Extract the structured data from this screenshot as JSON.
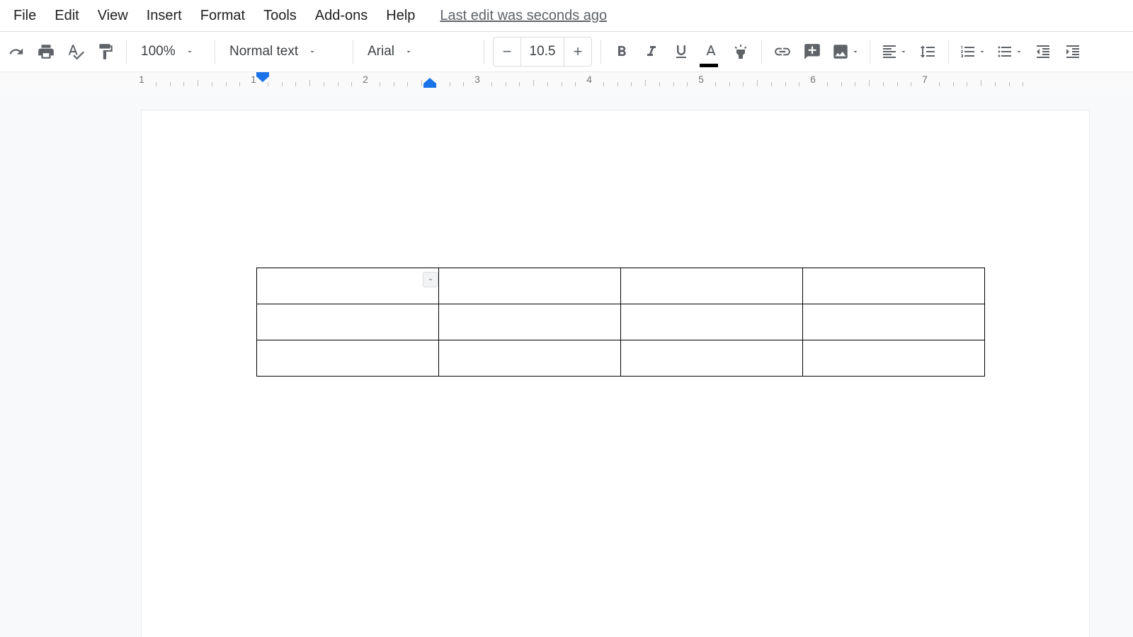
{
  "menu": {
    "items": [
      "File",
      "Edit",
      "View",
      "Insert",
      "Format",
      "Tools",
      "Add-ons",
      "Help"
    ],
    "last_edit": "Last edit was seconds ago"
  },
  "toolbar": {
    "zoom": "100%",
    "style": "Normal text",
    "font": "Arial",
    "font_size": "10.5"
  },
  "ruler": {
    "numbers": [
      "1",
      "1",
      "2",
      "3",
      "4",
      "5",
      "6",
      "7"
    ]
  },
  "table": {
    "rows": 3,
    "cols": 4
  }
}
